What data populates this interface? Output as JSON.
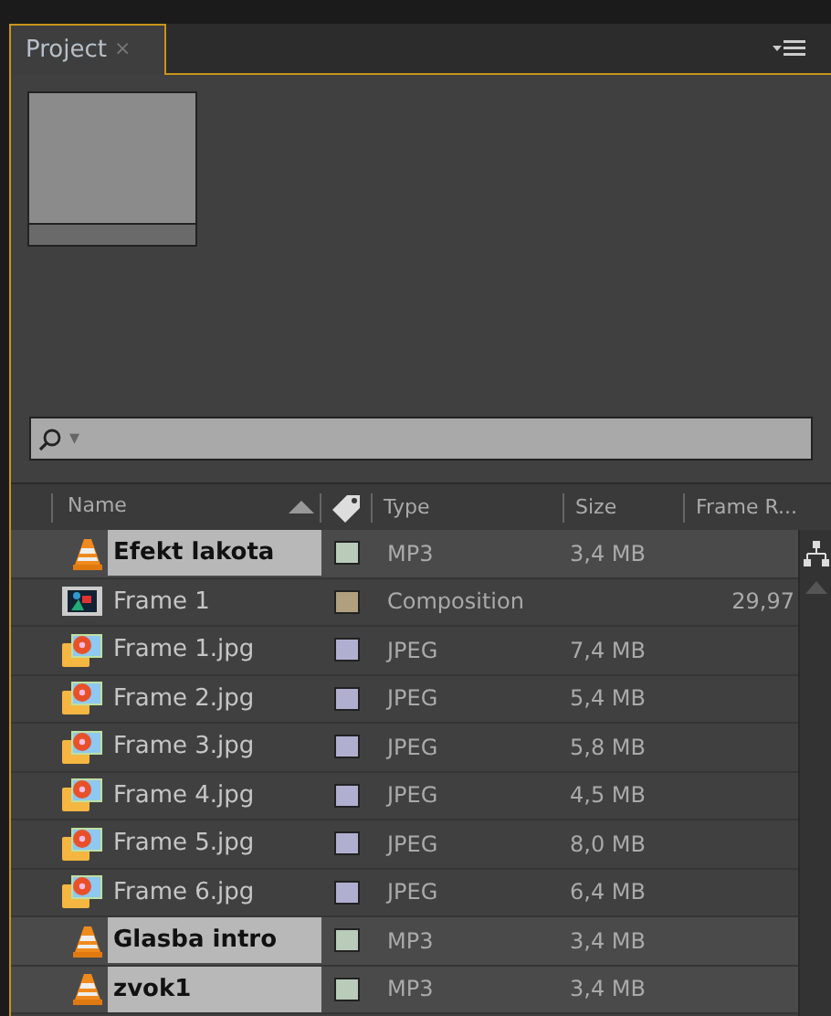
{
  "panel": {
    "tab": {
      "title": "Project",
      "close": "×",
      "selected": true
    }
  },
  "search": {
    "glyph": "▾"
  },
  "table": {
    "columns": [
      "Name",
      "Type",
      "Size",
      "Frame R..."
    ],
    "rows": [
      {
        "kind": "audio",
        "name": "Efekt lakota",
        "color": "#b9cbb9",
        "type": "MP3",
        "size": "3,4 MB",
        "selected": true
      },
      {
        "kind": "composition",
        "name": "Frame 1",
        "color": "#b0a07f",
        "type": "Composition",
        "frame_rate": "29,97",
        "selected": false
      },
      {
        "kind": "image",
        "name": "Frame 1.jpg",
        "color": "#b1afd0",
        "type": "JPEG",
        "size": "7,4 MB",
        "selected": false
      },
      {
        "kind": "image",
        "name": "Frame 2.jpg",
        "color": "#b1afd0",
        "type": "JPEG",
        "size": "5,4 MB",
        "selected": false
      },
      {
        "kind": "image",
        "name": "Frame 3.jpg",
        "color": "#b1afd0",
        "type": "JPEG",
        "size": "5,8 MB",
        "selected": false
      },
      {
        "kind": "image",
        "name": "Frame 4.jpg",
        "color": "#b1afd0",
        "type": "JPEG",
        "size": "4,5 MB",
        "selected": false
      },
      {
        "kind": "image",
        "name": "Frame 5.jpg",
        "color": "#b1afd0",
        "type": "JPEG",
        "size": "8,0 MB",
        "selected": false
      },
      {
        "kind": "image",
        "name": "Frame 6.jpg",
        "color": "#b1afd0",
        "type": "JPEG",
        "size": "6,4 MB",
        "selected": false
      },
      {
        "kind": "audio",
        "name": "Glasba intro",
        "color": "#b9cbb9",
        "type": "MP3",
        "size": "3,4 MB",
        "selected": true
      },
      {
        "kind": "audio",
        "name": "zvok1",
        "color": "#b9cbb9",
        "type": "MP3",
        "size": "3,4 MB",
        "selected": true
      }
    ]
  }
}
